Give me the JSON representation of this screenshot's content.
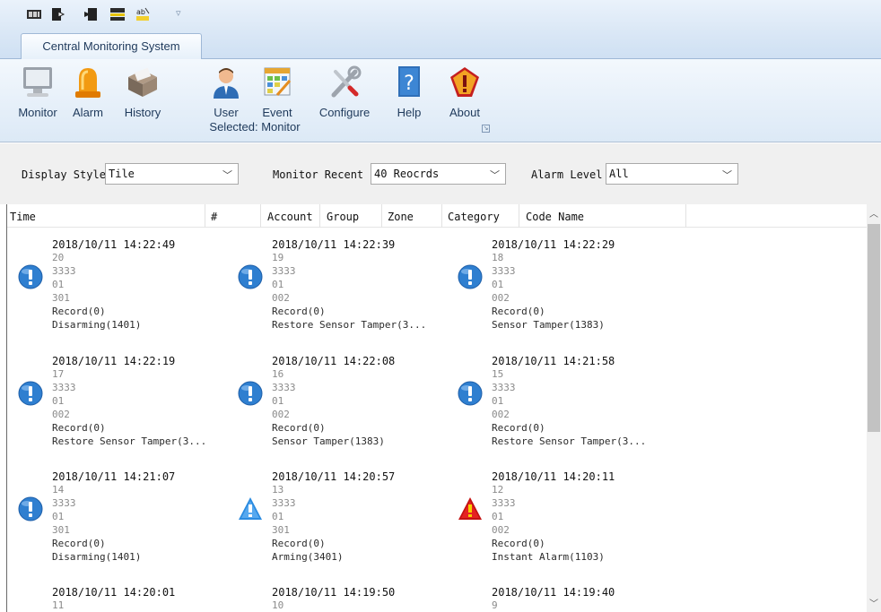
{
  "ribbon": {
    "tab_label": "Central Monitoring System",
    "buttons": [
      {
        "label": "Monitor",
        "icon": "monitor-icon"
      },
      {
        "label": "Alarm",
        "icon": "alarm-light-icon"
      },
      {
        "label": "History",
        "icon": "history-box-icon"
      },
      {
        "label": "User",
        "icon": "user-icon"
      },
      {
        "label": "Event",
        "icon": "event-calendar-icon"
      },
      {
        "label": "Configure",
        "icon": "tools-icon"
      },
      {
        "label": "Help",
        "icon": "help-icon"
      },
      {
        "label": "About",
        "icon": "about-shield-icon"
      }
    ],
    "group_footer": "Selected: Monitor"
  },
  "filters": {
    "display_style_label": "Display Style",
    "display_style_value": "Tile",
    "monitor_recent_label": "Monitor Recent",
    "monitor_recent_value": "40 Reocrds",
    "alarm_level_label": "Alarm Level",
    "alarm_level_value": "All"
  },
  "columns": [
    "Time",
    "#",
    "Account",
    "Group",
    "Zone",
    "Category",
    "Code Name"
  ],
  "colors": {
    "info_icon": "#2f7fd0",
    "warning_icon": "#2b8be0",
    "alarm_icon": "#d41515",
    "ribbon_text": "#1e395b"
  },
  "events": [
    {
      "time": "2018/10/11 14:22:49",
      "num": "20",
      "account": "3333",
      "group": "01",
      "zone": "301",
      "category": "Record(0)",
      "code": "Disarming(1401)",
      "icon": "info-icon"
    },
    {
      "time": "2018/10/11 14:22:39",
      "num": "19",
      "account": "3333",
      "group": "01",
      "zone": "002",
      "category": "Record(0)",
      "code": "Restore Sensor Tamper(3...",
      "icon": "info-icon"
    },
    {
      "time": "2018/10/11 14:22:29",
      "num": "18",
      "account": "3333",
      "group": "01",
      "zone": "002",
      "category": "Record(0)",
      "code": "Sensor Tamper(1383)",
      "icon": "info-icon"
    },
    {
      "time": "2018/10/11 14:22:19",
      "num": "17",
      "account": "3333",
      "group": "01",
      "zone": "002",
      "category": "Record(0)",
      "code": "Restore Sensor Tamper(3...",
      "icon": "info-icon"
    },
    {
      "time": "2018/10/11 14:22:08",
      "num": "16",
      "account": "3333",
      "group": "01",
      "zone": "002",
      "category": "Record(0)",
      "code": "Sensor Tamper(1383)",
      "icon": "info-icon"
    },
    {
      "time": "2018/10/11 14:21:58",
      "num": "15",
      "account": "3333",
      "group": "01",
      "zone": "002",
      "category": "Record(0)",
      "code": "Restore Sensor Tamper(3...",
      "icon": "info-icon"
    },
    {
      "time": "2018/10/11 14:21:07",
      "num": "14",
      "account": "3333",
      "group": "01",
      "zone": "301",
      "category": "Record(0)",
      "code": "Disarming(1401)",
      "icon": "info-icon"
    },
    {
      "time": "2018/10/11 14:20:57",
      "num": "13",
      "account": "3333",
      "group": "01",
      "zone": "301",
      "category": "Record(0)",
      "code": "Arming(3401)",
      "icon": "warning-icon"
    },
    {
      "time": "2018/10/11 14:20:11",
      "num": "12",
      "account": "3333",
      "group": "01",
      "zone": "002",
      "category": "Record(0)",
      "code": "Instant  Alarm(1103)",
      "icon": "alarm-icon"
    },
    {
      "time": "2018/10/11 14:20:01",
      "num": "11",
      "icon": "info-icon"
    },
    {
      "time": "2018/10/11 14:19:50",
      "num": "10",
      "icon": "info-icon"
    },
    {
      "time": "2018/10/11 14:19:40",
      "num": "9",
      "icon": "info-icon"
    }
  ]
}
